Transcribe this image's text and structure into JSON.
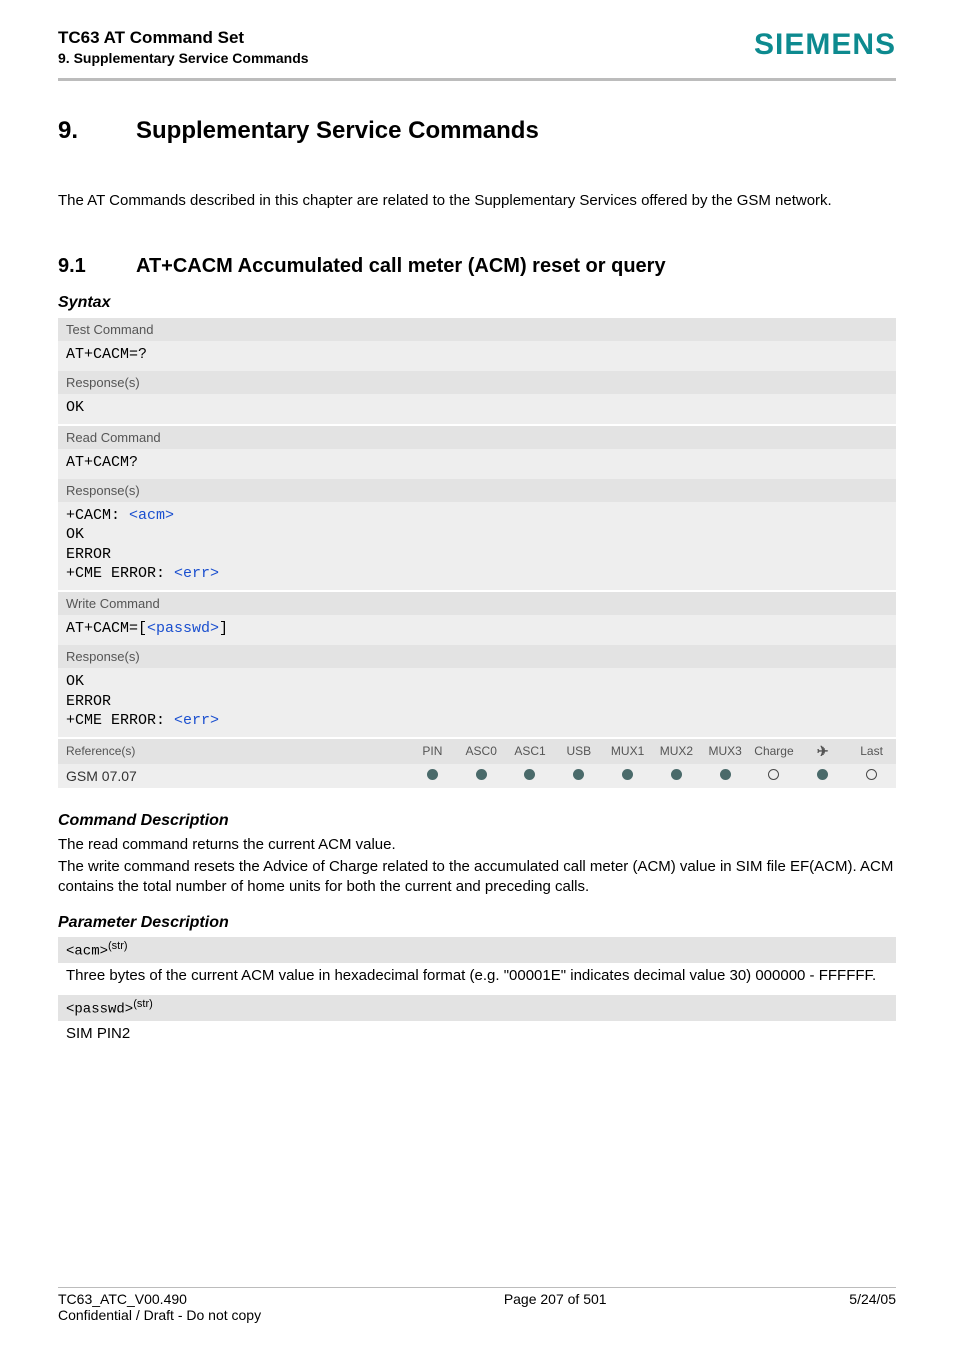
{
  "header": {
    "title": "TC63 AT Command Set",
    "subtitle": "9. Supplementary Service Commands",
    "brand": "SIEMENS"
  },
  "chapter": {
    "num": "9.",
    "title": "Supplementary Service Commands"
  },
  "intro": "The AT Commands described in this chapter are related to the Supplementary Services offered by the GSM network.",
  "section": {
    "num": "9.1",
    "title": "AT+CACM   Accumulated call meter (ACM) reset or query"
  },
  "syntax": {
    "label": "Syntax",
    "test_lbl": "Test Command",
    "test_cmd": "AT+CACM=?",
    "test_resp_lbl": "Response(s)",
    "test_resp": "OK",
    "read_lbl": "Read Command",
    "read_cmd": "AT+CACM?",
    "read_resp_lbl": "Response(s)",
    "read_resp_prefix": "+CACM: ",
    "read_resp_param": "<acm>",
    "read_resp_l2": "OK",
    "read_resp_l3": "ERROR",
    "read_resp_l4a": "+CME ERROR: ",
    "read_resp_l4b": "<err>",
    "write_lbl": "Write Command",
    "write_cmd_prefix": "AT+CACM=[",
    "write_cmd_param": "<passwd>",
    "write_cmd_suffix": "]",
    "write_resp_lbl": "Response(s)",
    "write_resp_l1": "OK",
    "write_resp_l2": "ERROR",
    "write_resp_l3a": "+CME ERROR: ",
    "write_resp_l3b": "<err>"
  },
  "refs": {
    "label": "Reference(s)",
    "value": "GSM 07.07",
    "cols": [
      "PIN",
      "ASC0",
      "ASC1",
      "USB",
      "MUX1",
      "MUX2",
      "MUX3",
      "Charge",
      "✈",
      "Last"
    ],
    "dots": [
      "solid",
      "solid",
      "solid",
      "solid",
      "solid",
      "solid",
      "solid",
      "open",
      "solid",
      "open"
    ]
  },
  "cmd_desc": {
    "label": "Command Description",
    "p1": "The read command returns the current ACM value.",
    "p2": "The write command resets the Advice of Charge related to the accumulated call meter (ACM) value in SIM file EF(ACM). ACM contains the total number of home units for both the current and preceding calls."
  },
  "param_desc": {
    "label": "Parameter Description",
    "p1_tag": "<acm>",
    "p1_sup": "(str)",
    "p1_body": "Three bytes of the current ACM value in hexadecimal format (e.g. \"00001E\" indicates decimal value 30) 000000 - FFFFFF.",
    "p2_tag": "<passwd>",
    "p2_sup": "(str)",
    "p2_body": "SIM PIN2"
  },
  "footer": {
    "left1": "TC63_ATC_V00.490",
    "left2": "Confidential / Draft - Do not copy",
    "center": "Page 207 of 501",
    "right": "5/24/05"
  }
}
